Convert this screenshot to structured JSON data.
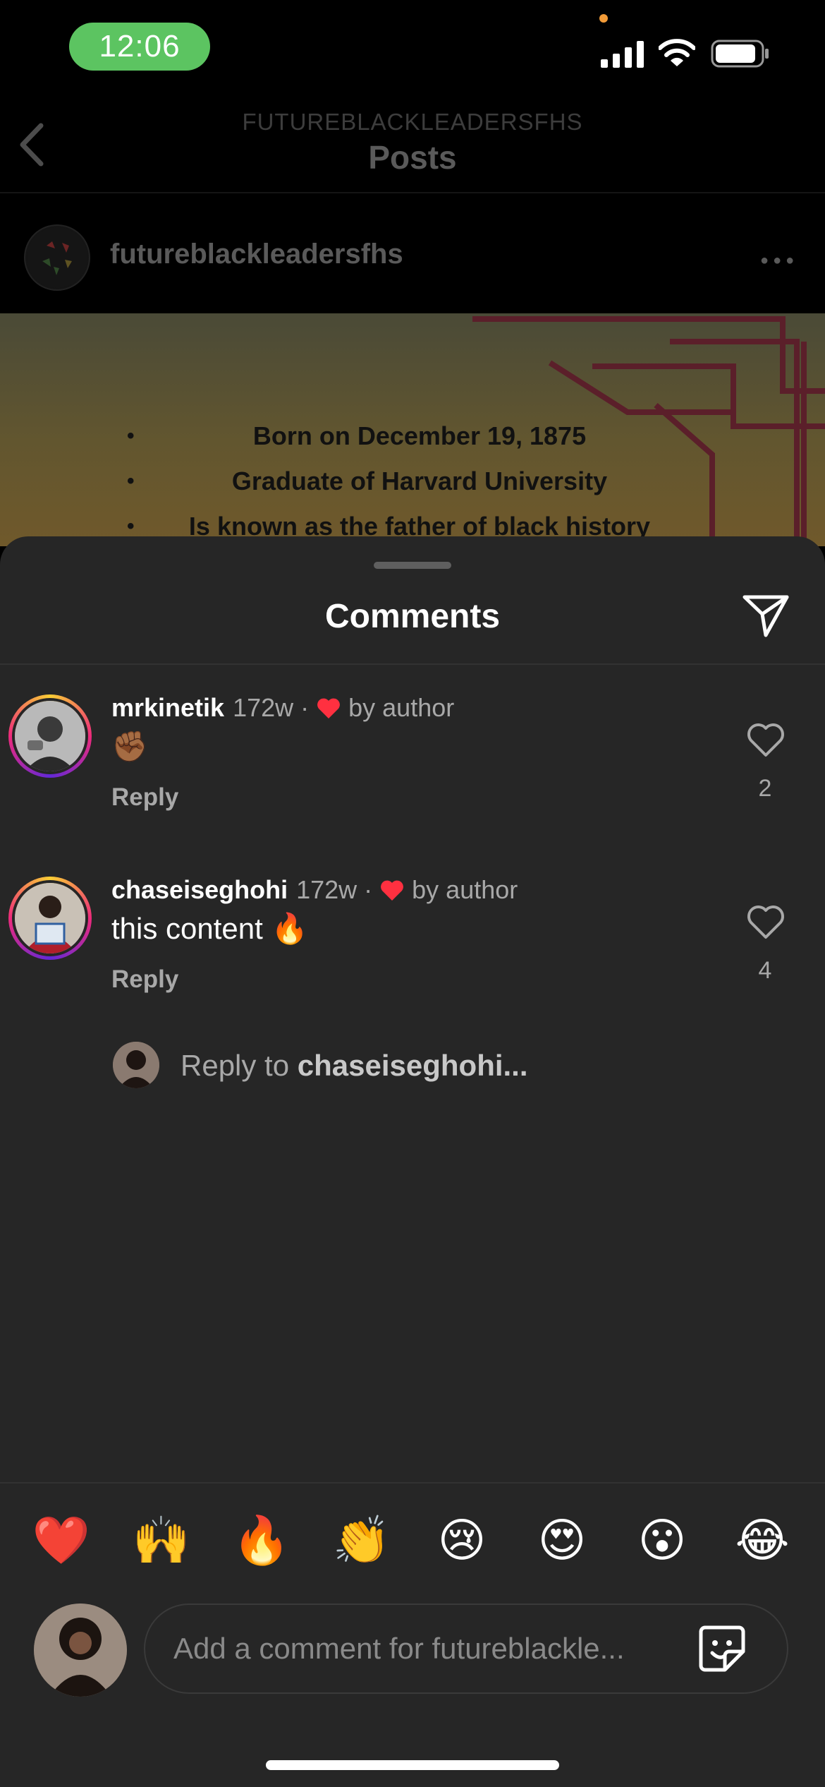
{
  "status_bar": {
    "time": "12:06"
  },
  "header": {
    "account": "FUTUREBLACKLEADERSFHS",
    "title": "Posts",
    "username": "futureblackleadersfhs"
  },
  "post": {
    "bullets": [
      "Born on December 19, 1875",
      "Graduate of Harvard University",
      "Is known as the father of black history"
    ]
  },
  "sheet": {
    "title": "Comments"
  },
  "comments": [
    {
      "username": "mrkinetik",
      "time": "172w",
      "separator": "·",
      "liked_by": "by author",
      "text": "✊🏾",
      "reply_label": "Reply",
      "likes": "2"
    },
    {
      "username": "chaseiseghohi",
      "time": "172w",
      "separator": "·",
      "liked_by": "by author",
      "text": "this content 🔥",
      "reply_label": "Reply",
      "likes": "4"
    }
  ],
  "reply_prompt": {
    "prefix": "Reply to",
    "target": "chaseiseghohi..."
  },
  "emoji_bar": [
    "❤️",
    "🙌",
    "🔥",
    "👏",
    "😢",
    "😍",
    "😮",
    "😂"
  ],
  "composer": {
    "placeholder": "Add a comment for futureblackle..."
  },
  "colors": {
    "like_red": "#ff3040",
    "time_pill": "#5cc461",
    "sheet_bg": "#262626"
  }
}
